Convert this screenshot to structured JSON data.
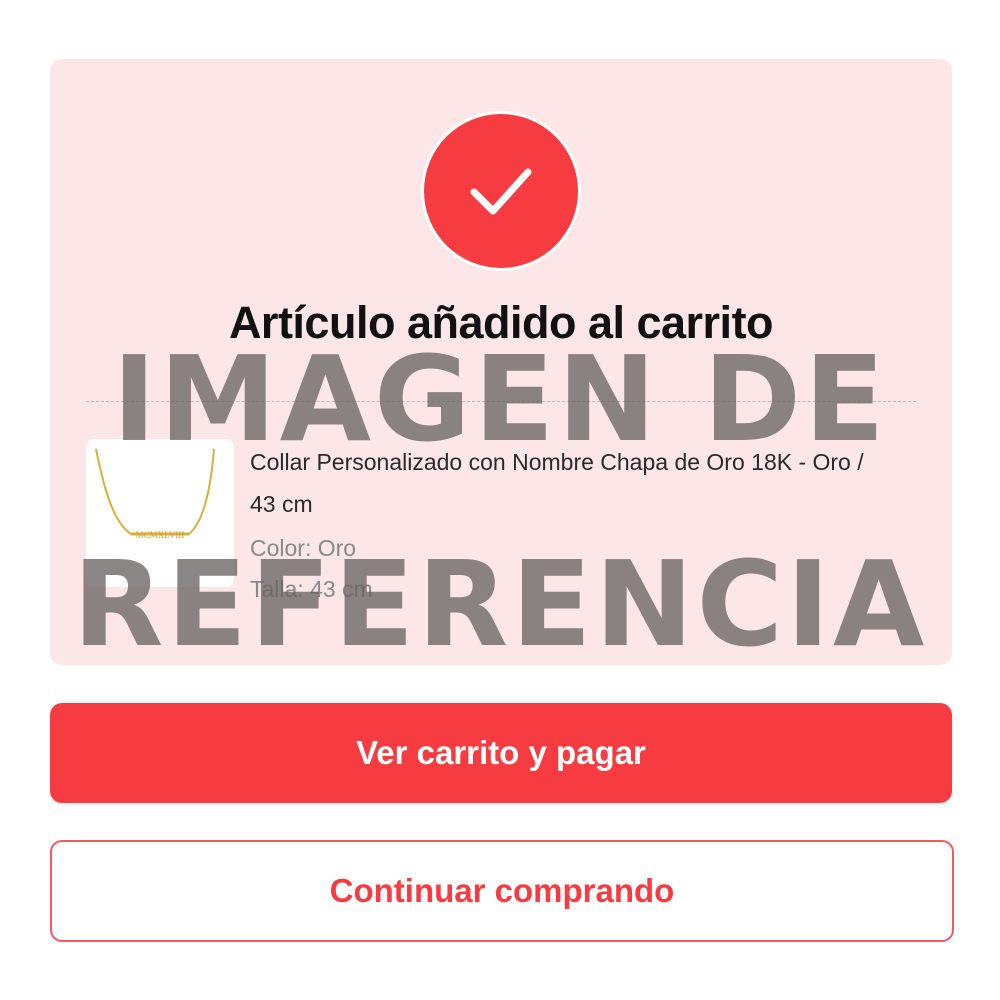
{
  "dialog": {
    "title": "Artículo añadido al carrito",
    "status_icon": "checkmark-icon"
  },
  "product": {
    "name": "Collar Personalizado con Nombre Chapa de Oro 18K - Oro / 43 cm",
    "color": "Color: Oro",
    "size": "Talla: 43 cm",
    "thumbnail_engraving": "MCMXLVIII"
  },
  "actions": {
    "checkout_label": "Ver carrito y pagar",
    "continue_label": "Continuar comprando"
  },
  "watermark": {
    "line1": "IMAGEN DE",
    "line2": "REFERENCIA"
  },
  "colors": {
    "accent": "#f73c41",
    "card_background": "#fde6e7"
  }
}
